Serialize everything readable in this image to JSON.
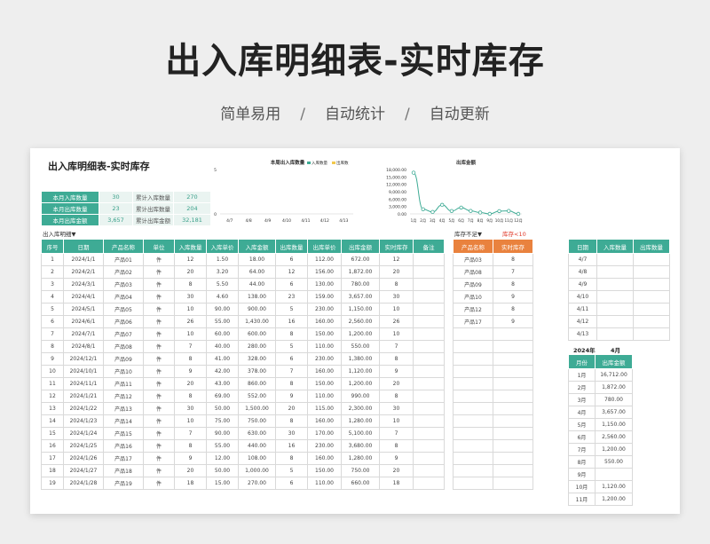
{
  "hero": {
    "title": "出入库明细表-实时库存",
    "tags": [
      "简单易用",
      "自动统计",
      "自动更新"
    ],
    "separator": "/"
  },
  "sheet": {
    "title": "出入库明细表-实时库存",
    "kpis": [
      {
        "label": "本月入库数量",
        "value": "30",
        "label2": "累计入库数量",
        "value2": "270"
      },
      {
        "label": "本月出库数量",
        "value": "23",
        "label2": "累计出库数量",
        "value2": "204"
      },
      {
        "label": "本月出库金额",
        "value": "3,657",
        "label2": "累计出库金额",
        "value2": "32,181"
      }
    ],
    "detail_caption": "出入库明细▼",
    "stock_caption": "库存不足▼",
    "stock_threshold": "库存<10",
    "month_selector": {
      "year": "2024年",
      "month": "4月"
    }
  },
  "detail": {
    "headers": [
      "序号",
      "日期",
      "产品名称",
      "单位",
      "入库数量",
      "入库单价",
      "入库金额",
      "出库数量",
      "出库单价",
      "出库金额",
      "实时库存",
      "备注"
    ],
    "rows": [
      [
        "1",
        "2024/1/1",
        "产品01",
        "件",
        "12",
        "1.50",
        "18.00",
        "6",
        "112.00",
        "672.00",
        "12",
        ""
      ],
      [
        "2",
        "2024/2/1",
        "产品02",
        "件",
        "20",
        "3.20",
        "64.00",
        "12",
        "156.00",
        "1,872.00",
        "20",
        ""
      ],
      [
        "3",
        "2024/3/1",
        "产品03",
        "件",
        "8",
        "5.50",
        "44.00",
        "6",
        "130.00",
        "780.00",
        "8",
        ""
      ],
      [
        "4",
        "2024/4/1",
        "产品04",
        "件",
        "30",
        "4.60",
        "138.00",
        "23",
        "159.00",
        "3,657.00",
        "30",
        ""
      ],
      [
        "5",
        "2024/5/1",
        "产品05",
        "件",
        "10",
        "90.00",
        "900.00",
        "5",
        "230.00",
        "1,150.00",
        "10",
        ""
      ],
      [
        "6",
        "2024/6/1",
        "产品06",
        "件",
        "26",
        "55.00",
        "1,430.00",
        "16",
        "160.00",
        "2,560.00",
        "26",
        ""
      ],
      [
        "7",
        "2024/7/1",
        "产品07",
        "件",
        "10",
        "60.00",
        "600.00",
        "8",
        "150.00",
        "1,200.00",
        "10",
        ""
      ],
      [
        "8",
        "2024/8/1",
        "产品08",
        "件",
        "7",
        "40.00",
        "280.00",
        "5",
        "110.00",
        "550.00",
        "7",
        ""
      ],
      [
        "9",
        "2024/12/1",
        "产品09",
        "件",
        "8",
        "41.00",
        "328.00",
        "6",
        "230.00",
        "1,380.00",
        "8",
        ""
      ],
      [
        "10",
        "2024/10/1",
        "产品10",
        "件",
        "9",
        "42.00",
        "378.00",
        "7",
        "160.00",
        "1,120.00",
        "9",
        ""
      ],
      [
        "11",
        "2024/11/1",
        "产品11",
        "件",
        "20",
        "43.00",
        "860.00",
        "8",
        "150.00",
        "1,200.00",
        "20",
        ""
      ],
      [
        "12",
        "2024/1/21",
        "产品12",
        "件",
        "8",
        "69.00",
        "552.00",
        "9",
        "110.00",
        "990.00",
        "8",
        ""
      ],
      [
        "13",
        "2024/1/22",
        "产品13",
        "件",
        "30",
        "50.00",
        "1,500.00",
        "20",
        "115.00",
        "2,300.00",
        "30",
        ""
      ],
      [
        "14",
        "2024/1/23",
        "产品14",
        "件",
        "10",
        "75.00",
        "750.00",
        "8",
        "160.00",
        "1,280.00",
        "10",
        ""
      ],
      [
        "15",
        "2024/1/24",
        "产品15",
        "件",
        "7",
        "90.00",
        "630.00",
        "30",
        "170.00",
        "5,100.00",
        "7",
        ""
      ],
      [
        "16",
        "2024/1/25",
        "产品16",
        "件",
        "8",
        "55.00",
        "440.00",
        "16",
        "230.00",
        "3,680.00",
        "8",
        ""
      ],
      [
        "17",
        "2024/1/26",
        "产品17",
        "件",
        "9",
        "12.00",
        "108.00",
        "8",
        "160.00",
        "1,280.00",
        "9",
        ""
      ],
      [
        "18",
        "2024/1/27",
        "产品18",
        "件",
        "20",
        "50.00",
        "1,000.00",
        "5",
        "150.00",
        "750.00",
        "20",
        ""
      ],
      [
        "19",
        "2024/1/28",
        "产品19",
        "件",
        "18",
        "15.00",
        "270.00",
        "6",
        "110.00",
        "660.00",
        "18",
        ""
      ]
    ]
  },
  "stock": {
    "headers": [
      "产品名称",
      "实时库存"
    ],
    "rows": [
      [
        "产品03",
        "8"
      ],
      [
        "产品08",
        "7"
      ],
      [
        "产品09",
        "8"
      ],
      [
        "产品10",
        "9"
      ],
      [
        "产品12",
        "8"
      ],
      [
        "产品17",
        "9"
      ]
    ],
    "blank_rows": 13
  },
  "weekly": {
    "headers": [
      "日期",
      "入库数量",
      "出库数量"
    ],
    "rows": [
      [
        "4/7",
        "",
        ""
      ],
      [
        "4/8",
        "",
        ""
      ],
      [
        "4/9",
        "",
        ""
      ],
      [
        "4/10",
        "",
        ""
      ],
      [
        "4/11",
        "",
        ""
      ],
      [
        "4/12",
        "",
        ""
      ],
      [
        "4/13",
        "",
        ""
      ]
    ]
  },
  "monthly": {
    "headers": [
      "月份",
      "出库金额"
    ],
    "rows": [
      [
        "1月",
        "16,712.00"
      ],
      [
        "2月",
        "1,872.00"
      ],
      [
        "3月",
        "780.00"
      ],
      [
        "4月",
        "3,657.00"
      ],
      [
        "5月",
        "1,150.00"
      ],
      [
        "6月",
        "2,560.00"
      ],
      [
        "7月",
        "1,200.00"
      ],
      [
        "8月",
        "550.00"
      ],
      [
        "9月",
        ""
      ],
      [
        "10月",
        "1,120.00"
      ],
      [
        "11月",
        "1,200.00"
      ]
    ]
  },
  "colors": {
    "teal": "#3eab95",
    "orange": "#e9823e",
    "yellow": "#f2c84b",
    "alert_red": "#e03a2a"
  },
  "chart_data": [
    {
      "type": "bar",
      "title": "本周出入库数量",
      "categories": [
        "4/7",
        "4/8",
        "4/9",
        "4/10",
        "4/11",
        "4/12",
        "4/13"
      ],
      "series": [
        {
          "name": "入库数量",
          "values": [
            0,
            0,
            0,
            0,
            0,
            0,
            0
          ],
          "color": "#3eab95"
        },
        {
          "name": "出库数",
          "values": [
            0,
            0,
            0,
            0,
            0,
            0,
            0
          ],
          "color": "#f2c84b"
        }
      ],
      "ylim": [
        0,
        5
      ],
      "yticks": [
        "5",
        "0"
      ],
      "legend": "top",
      "grid": false
    },
    {
      "type": "line",
      "title": "出库金额",
      "categories": [
        "1月",
        "2月",
        "3月",
        "4月",
        "5月",
        "6月",
        "7月",
        "8月",
        "9月",
        "10月",
        "11月",
        "12月"
      ],
      "series": [
        {
          "values": [
            16712,
            1872,
            780,
            3657,
            1150,
            2560,
            1200,
            550,
            0,
            1120,
            1200,
            0
          ],
          "color": "#3eab95"
        }
      ],
      "ylim": [
        0,
        18000
      ],
      "yticks": [
        "18,000.00",
        "15,000.00",
        "12,000.00",
        "9,000.00",
        "6,000.00",
        "3,000.00",
        "0.00"
      ],
      "grid": false
    }
  ]
}
